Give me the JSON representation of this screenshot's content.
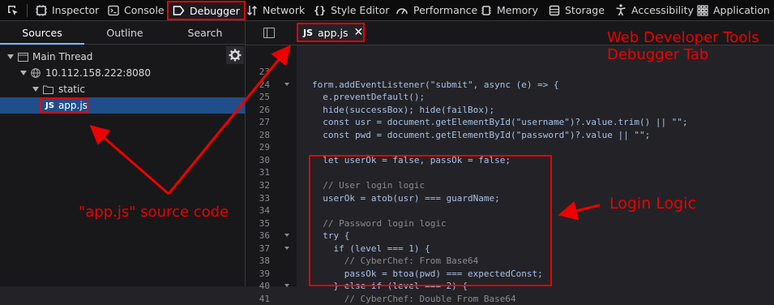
{
  "toolbar": {
    "tabs": [
      {
        "label": "Inspector",
        "icon": "inspector-icon"
      },
      {
        "label": "Console",
        "icon": "console-icon"
      },
      {
        "label": "Debugger",
        "icon": "debugger-icon",
        "active": true
      },
      {
        "label": "Network",
        "icon": "network-icon"
      },
      {
        "label": "Style Editor",
        "icon": "style-editor-icon"
      },
      {
        "label": "Performance",
        "icon": "performance-icon"
      },
      {
        "label": "Memory",
        "icon": "memory-icon"
      },
      {
        "label": "Storage",
        "icon": "storage-icon"
      },
      {
        "label": "Accessibility",
        "icon": "accessibility-icon"
      },
      {
        "label": "Application",
        "icon": "application-icon"
      }
    ]
  },
  "sidebar": {
    "tabs": [
      "Sources",
      "Outline",
      "Search"
    ],
    "tree": [
      {
        "label": "Main Thread",
        "icon": "window-icon"
      },
      {
        "label": "10.112.158.222:8080",
        "icon": "globe-icon"
      },
      {
        "label": "static",
        "icon": "folder-icon"
      },
      {
        "label": "app.js",
        "icon": "js-icon",
        "selected": true
      }
    ]
  },
  "editor": {
    "file_tab": {
      "badge": "JS",
      "label": "app.js",
      "close": "✕"
    },
    "lines": [
      {
        "n": "23",
        "fold": false,
        "text": "",
        "comment": false
      },
      {
        "n": "24",
        "fold": true,
        "text": "form.addEventListener(\"submit\", async (e) => {",
        "comment": false
      },
      {
        "n": "25",
        "fold": false,
        "text": "  e.preventDefault();",
        "comment": false
      },
      {
        "n": "26",
        "fold": false,
        "text": "  hide(successBox); hide(failBox);",
        "comment": false
      },
      {
        "n": "27",
        "fold": false,
        "text": "  const usr = document.getElementById(\"username\")?.value.trim() || \"\";",
        "comment": false
      },
      {
        "n": "28",
        "fold": false,
        "text": "  const pwd = document.getElementById(\"password\")?.value || \"\";",
        "comment": false
      },
      {
        "n": "29",
        "fold": false,
        "text": "",
        "comment": false
      },
      {
        "n": "30",
        "fold": false,
        "text": "  let userOk = false, passOk = false;",
        "comment": false
      },
      {
        "n": "31",
        "fold": false,
        "text": "",
        "comment": false
      },
      {
        "n": "32",
        "fold": false,
        "text": "  // User login logic",
        "comment": true
      },
      {
        "n": "33",
        "fold": false,
        "text": "  userOk = atob(usr) === guardName;",
        "comment": false
      },
      {
        "n": "34",
        "fold": false,
        "text": "",
        "comment": false
      },
      {
        "n": "35",
        "fold": false,
        "text": "  // Password login logic",
        "comment": true
      },
      {
        "n": "36",
        "fold": true,
        "text": "  try {",
        "comment": false
      },
      {
        "n": "37",
        "fold": true,
        "text": "    if (level === 1) {",
        "comment": false
      },
      {
        "n": "38",
        "fold": false,
        "text": "      // CyberChef: From Base64",
        "comment": true
      },
      {
        "n": "39",
        "fold": false,
        "text": "      passOk = btoa(pwd) === expectedConst;",
        "comment": false
      },
      {
        "n": "40",
        "fold": true,
        "text": "    } else if (level === 2) {",
        "comment": false
      },
      {
        "n": "41",
        "fold": false,
        "text": "      // CyberChef: Double From Base64",
        "comment": true
      }
    ]
  },
  "annotations": {
    "title_line1": "Web Developer Tools",
    "title_line2": "Debugger Tab",
    "source_code_label": "\"app.js\" source code",
    "login_logic_label": "Login Logic",
    "color": "#e00000"
  }
}
